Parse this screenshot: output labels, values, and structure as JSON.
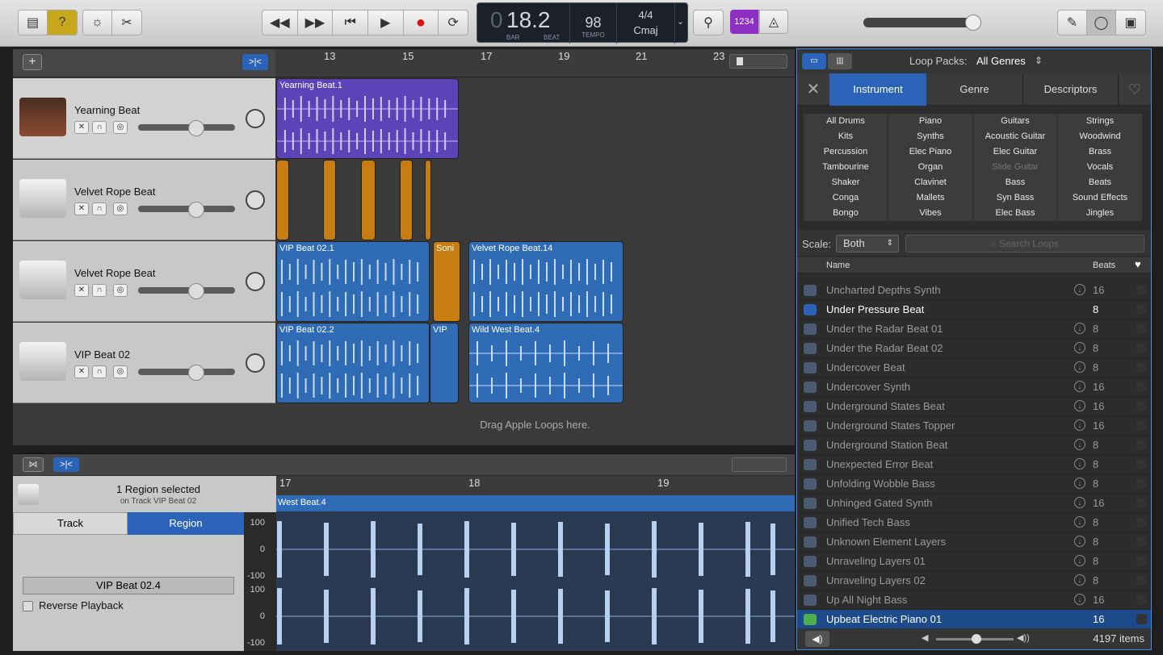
{
  "toolbar": {
    "lcd": {
      "bar": "0",
      "beat_value": "18.2",
      "bar_label": "BAR",
      "beat_label": "BEAT",
      "tempo": "98",
      "tempo_label": "TEMPO",
      "signature": "4/4",
      "key": "Cmaj"
    },
    "count_in": "1234"
  },
  "ruler": {
    "marks": [
      "13",
      "15",
      "17",
      "19",
      "21",
      "23"
    ]
  },
  "tracks": [
    {
      "name": "Yearning Beat",
      "icon": "amp-icon"
    },
    {
      "name": "Velvet Rope Beat",
      "icon": "drum-machine-icon"
    },
    {
      "name": "Velvet Rope Beat",
      "icon": "drum-machine-icon"
    },
    {
      "name": "VIP Beat 02",
      "icon": "drum-machine-icon"
    }
  ],
  "regions": {
    "r1": "Yearning Beat.1",
    "r2": "VIP Beat 02.1",
    "r3": "Soni",
    "r4": "Velvet Rope Beat.14",
    "r5": "VIP Beat 02.2",
    "r6": "VIP",
    "r7": "Wild West Beat.4"
  },
  "drop_hint": "Drag Apple Loops here.",
  "editor": {
    "selected": "1 Region selected",
    "on_track": "on Track VIP Beat 02",
    "tab_track": "Track",
    "tab_region": "Region",
    "region_name": "VIP Beat 02.4",
    "reverse": "Reverse Playback",
    "ruler": [
      "17",
      "18",
      "19"
    ],
    "region_label": "West Beat.4",
    "scale": [
      "100",
      "0",
      "-100",
      "100",
      "0",
      "-100"
    ]
  },
  "loops": {
    "packs_label": "Loop Packs:",
    "packs_value": "All Genres",
    "tabs": [
      "Instrument",
      "Genre",
      "Descriptors"
    ],
    "keywords": [
      [
        "All Drums",
        "Piano",
        "Guitars",
        "Strings"
      ],
      [
        "Kits",
        "Synths",
        "Acoustic Guitar",
        "Woodwind"
      ],
      [
        "Percussion",
        "Elec Piano",
        "Elec Guitar",
        "Brass"
      ],
      [
        "Tambourine",
        "Organ",
        "Slide Guitar",
        "Vocals"
      ],
      [
        "Shaker",
        "Clavinet",
        "Bass",
        "Beats"
      ],
      [
        "Conga",
        "Mallets",
        "Syn Bass",
        "Sound Effects"
      ],
      [
        "Bongo",
        "Vibes",
        "Elec Bass",
        "Jingles"
      ]
    ],
    "scale_label": "Scale:",
    "scale_value": "Both",
    "search_placeholder": "Search Loops",
    "col_name": "Name",
    "col_beats": "Beats",
    "rows": [
      {
        "name": "Uncharted Depths Synth",
        "beats": "16",
        "dl": true
      },
      {
        "name": "Under Pressure Beat",
        "beats": "8",
        "dl": false,
        "hl": true
      },
      {
        "name": "Under the Radar Beat 01",
        "beats": "8",
        "dl": true
      },
      {
        "name": "Under the Radar Beat 02",
        "beats": "8",
        "dl": true
      },
      {
        "name": "Undercover Beat",
        "beats": "8",
        "dl": true
      },
      {
        "name": "Undercover Synth",
        "beats": "16",
        "dl": true
      },
      {
        "name": "Underground States Beat",
        "beats": "16",
        "dl": true
      },
      {
        "name": "Underground States Topper",
        "beats": "16",
        "dl": true
      },
      {
        "name": "Underground Station Beat",
        "beats": "8",
        "dl": true
      },
      {
        "name": "Unexpected Error Beat",
        "beats": "8",
        "dl": true
      },
      {
        "name": "Unfolding Wobble Bass",
        "beats": "8",
        "dl": true
      },
      {
        "name": "Unhinged Gated Synth",
        "beats": "16",
        "dl": true
      },
      {
        "name": "Unified Tech Bass",
        "beats": "8",
        "dl": true
      },
      {
        "name": "Unknown Element Layers",
        "beats": "8",
        "dl": true
      },
      {
        "name": "Unraveling Layers 01",
        "beats": "8",
        "dl": true
      },
      {
        "name": "Unraveling Layers 02",
        "beats": "8",
        "dl": true
      },
      {
        "name": "Up All Night Bass",
        "beats": "16",
        "dl": true
      },
      {
        "name": "Upbeat Electric Piano 01",
        "beats": "16",
        "dl": false,
        "sel": true
      }
    ],
    "count": "4197 items"
  }
}
